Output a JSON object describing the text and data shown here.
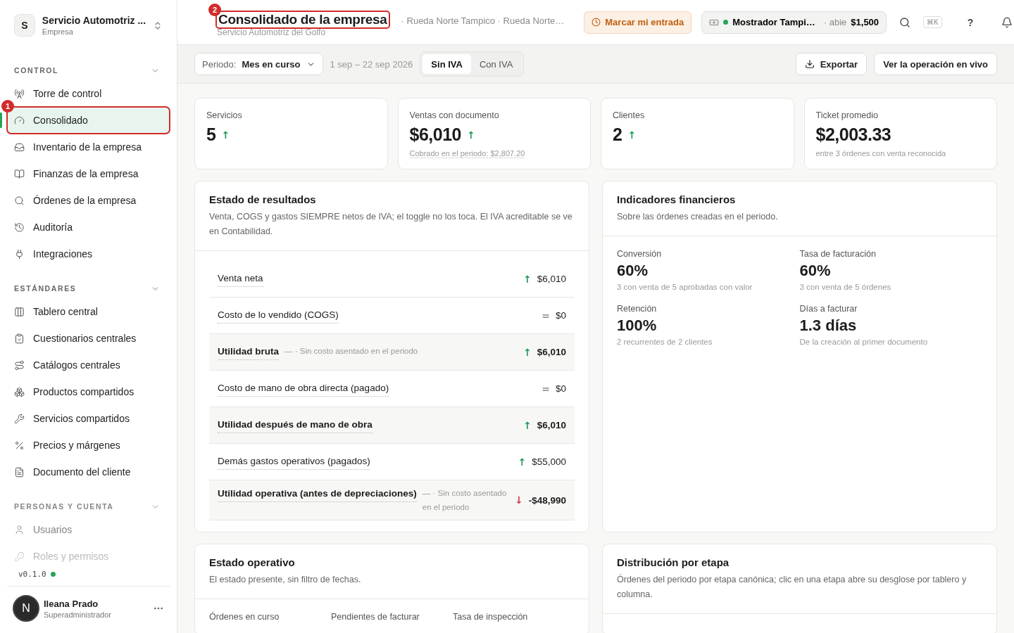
{
  "sidebar": {
    "org": {
      "initial": "S",
      "name": "Servicio Automotriz ...",
      "type": "Empresa"
    },
    "sections": [
      {
        "title": "CONTROL",
        "expanded": true,
        "items": [
          {
            "label": "Torre de control",
            "selected": false
          },
          {
            "label": "Consolidado",
            "selected": true,
            "annotation": "1"
          },
          {
            "label": "Inventario de la empresa",
            "selected": false
          },
          {
            "label": "Finanzas de la empresa",
            "selected": false
          },
          {
            "label": "Órdenes de la empresa",
            "selected": false
          },
          {
            "label": "Auditoría",
            "selected": false
          },
          {
            "label": "Integraciones",
            "selected": false
          }
        ]
      },
      {
        "title": "ESTÁNDARES",
        "expanded": true,
        "items": [
          {
            "label": "Tablero central",
            "selected": false
          },
          {
            "label": "Cuestionarios centrales",
            "selected": false
          },
          {
            "label": "Catálogos centrales",
            "selected": false
          },
          {
            "label": "Productos compartidos",
            "selected": false
          },
          {
            "label": "Servicios compartidos",
            "selected": false
          },
          {
            "label": "Precios y márgenes",
            "selected": false
          },
          {
            "label": "Documento del cliente",
            "selected": false
          }
        ]
      },
      {
        "title": "PERSONAS Y CUENTA",
        "expanded": true,
        "items": [
          {
            "label": "Usuarios",
            "selected": false
          },
          {
            "label": "Roles y permisos",
            "selected": false
          }
        ]
      }
    ],
    "version": "v0.1.0",
    "user": {
      "initial": "N",
      "name": "Ileana Prado",
      "role": "Superadministrador"
    }
  },
  "header": {
    "title": "Consolidado de la empresa",
    "title_annotation": "2",
    "subtitle": "Servicio Automotriz del Golfo",
    "breadcrumb": "· Rueda Norte Tampico · Rueda Norte…",
    "clock_in": "Marcar mi entrada",
    "register": {
      "name": "Mostrador Tampi…",
      "status": "· abie",
      "amount": "$1,500"
    },
    "shortcut": "⌘K",
    "help": "?"
  },
  "toolbar": {
    "period_label": "Periodo:",
    "period_value": "Mes en curso",
    "range": "1 sep – 22 sep 2026",
    "tax_tabs": [
      {
        "label": "Sin IVA",
        "selected": true
      },
      {
        "label": "Con IVA",
        "selected": false
      }
    ],
    "export": "Exportar",
    "live": "Ver la operación en vivo"
  },
  "kpis": [
    {
      "label": "Servicios",
      "value": "5",
      "trend": "↑",
      "color": "#1f9a55"
    },
    {
      "label": "Ventas con documento",
      "value": "$6,010",
      "trend": "↑",
      "color": "#1f9a55",
      "note": "Cobrado en el periodo: $2,807.20"
    },
    {
      "label": "Clientes",
      "value": "2",
      "trend": "↑",
      "color": "#1f9a55"
    },
    {
      "label": "Ticket promedio",
      "value": "$2,003.33",
      "note": "entre 3 órdenes con venta reconocida"
    }
  ],
  "income_statement": {
    "title": "Estado de resultados",
    "subtitle": "Venta, COGS y gastos SIEMPRE netos de IVA; el toggle no los toca. El IVA acreditable se ve en Contabilidad.",
    "rows": [
      {
        "label": "Venta neta",
        "kind": "line",
        "trend": "↑",
        "color": "#1f9a55",
        "value": "$6,010"
      },
      {
        "label": "Costo de lo vendido (COGS)",
        "kind": "line",
        "trend": "=",
        "color": "#9a9a9a",
        "value": "$0"
      },
      {
        "label": "Utilidad bruta",
        "kind": "subtotal",
        "note": "— · Sin costo asentado en el periodo",
        "trend": "↑",
        "color": "#1f9a55",
        "value": "$6,010"
      },
      {
        "label": "Costo de mano de obra directa (pagado)",
        "kind": "line",
        "trend": "=",
        "color": "#9a9a9a",
        "value": "$0"
      },
      {
        "label": "Utilidad después de mano de obra",
        "kind": "subtotal",
        "trend": "↑",
        "color": "#1f9a55",
        "value": "$6,010"
      },
      {
        "label": "Demás gastos operativos (pagados)",
        "kind": "line",
        "trend": "↑",
        "color": "#1f9a55",
        "value": "$55,000"
      },
      {
        "label": "Utilidad operativa (antes de depreciaciones)",
        "kind": "subtotal",
        "note": "— · Sin costo asentado en el periodo",
        "trend": "↓",
        "color": "#d23b3b",
        "value": "-$48,990"
      }
    ]
  },
  "indicators": {
    "title": "Indicadores financieros",
    "subtitle": "Sobre las órdenes creadas en el periodo.",
    "items": [
      {
        "label": "Conversión",
        "value": "60%",
        "note": "3 con venta de 5 aprobadas con valor"
      },
      {
        "label": "Tasa de facturación",
        "value": "60%",
        "note": "3 con venta de 5 órdenes"
      },
      {
        "label": "Retención",
        "value": "100%",
        "note": "2 recurrentes de 2 clientes"
      },
      {
        "label": "Días a facturar",
        "value": "1.3 días",
        "note": "De la creación al primer documento"
      }
    ]
  },
  "operations": {
    "title": "Estado operativo",
    "subtitle": "El estado presente, sin filtro de fechas.",
    "columns": [
      "Órdenes en curso",
      "Pendientes de facturar",
      "Tasa de inspección"
    ]
  },
  "stage_distribution": {
    "title": "Distribución por etapa",
    "subtitle": "Órdenes del periodo por etapa canónica; clic en una etapa abre su desglose por tablero y columna."
  }
}
